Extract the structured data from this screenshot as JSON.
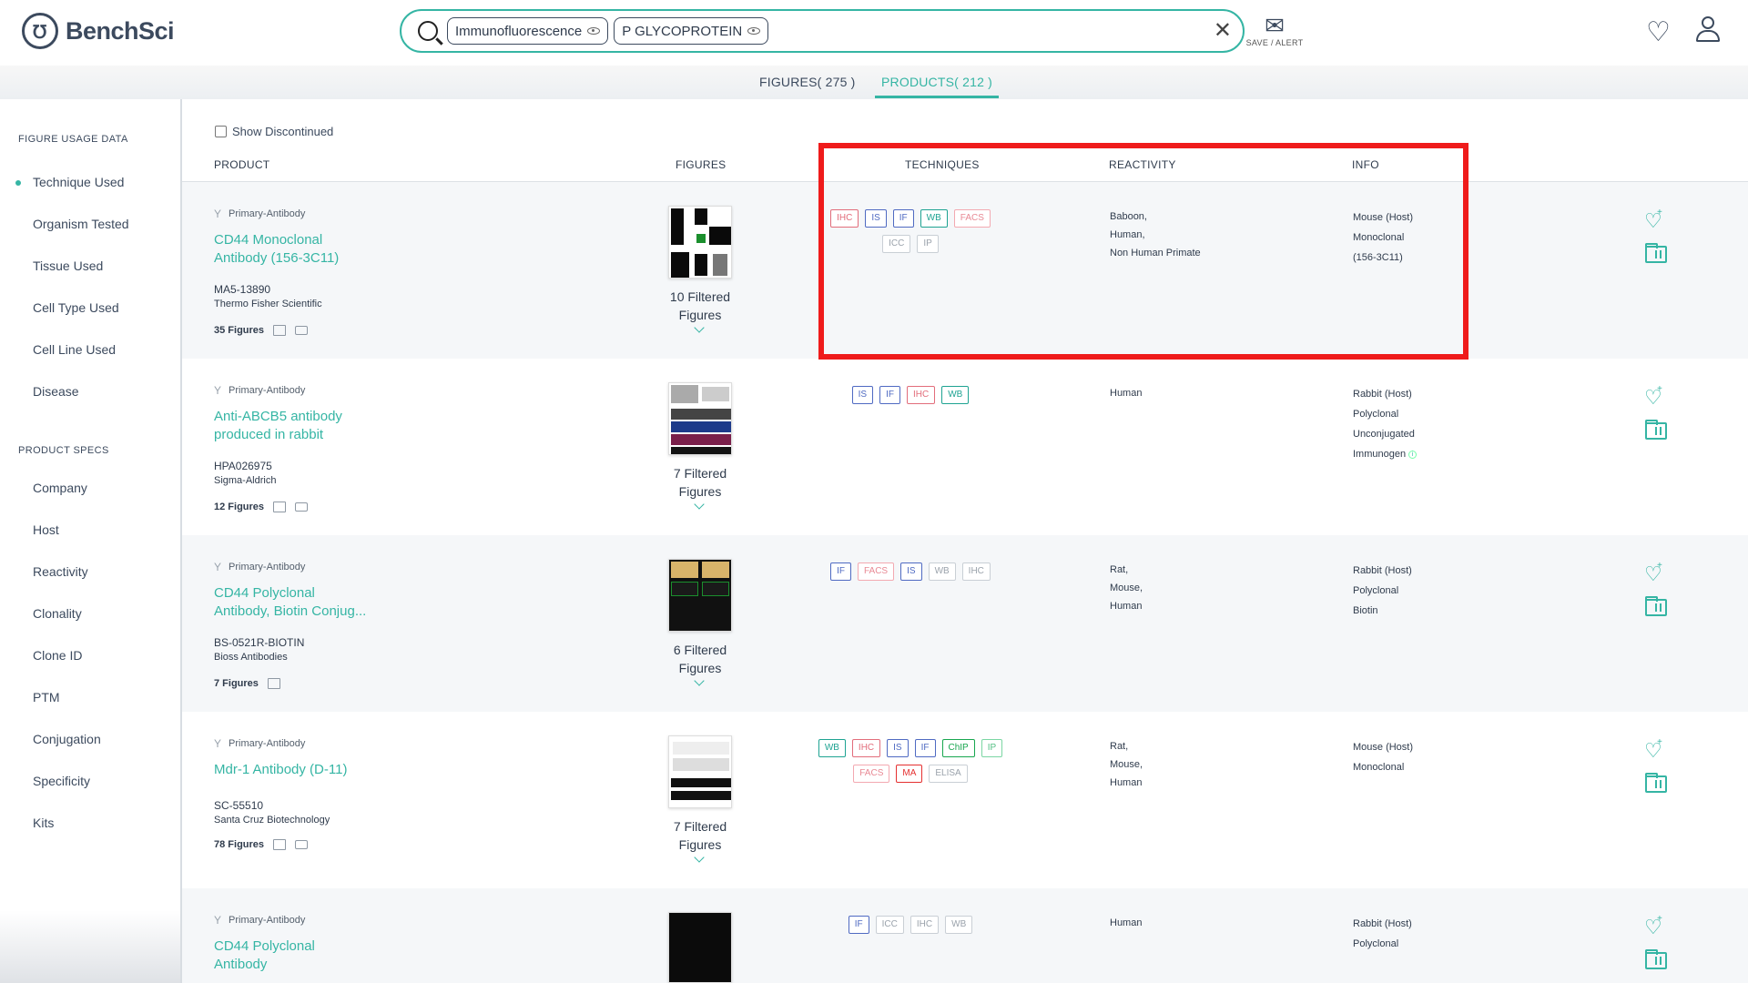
{
  "header": {
    "logo_text": "BenchSci",
    "search_chips": [
      "Immunofluorescence",
      "P GLYCOPROTEIN"
    ],
    "save_alert_label": "SAVE / ALERT"
  },
  "tabs": {
    "figures_label": "FIGURES",
    "figures_count": "( 275 )",
    "products_label": "PRODUCTS",
    "products_count": "( 212 )"
  },
  "sidebar": {
    "figure_usage_title": "FIGURE USAGE DATA",
    "figure_usage_items": [
      "Technique Used",
      "Organism Tested",
      "Tissue Used",
      "Cell Type Used",
      "Cell Line Used",
      "Disease"
    ],
    "product_specs_title": "PRODUCT SPECS",
    "product_specs_items": [
      "Company",
      "Host",
      "Reactivity",
      "Clonality",
      "Clone ID",
      "PTM",
      "Conjugation",
      "Specificity",
      "Kits"
    ]
  },
  "main": {
    "show_discontinued_label": "Show Discontinued",
    "columns": {
      "product": "PRODUCT",
      "figures": "FIGURES",
      "techniques": "TECHNIQUES",
      "reactivity": "REACTIVITY",
      "info": "INFO"
    }
  },
  "products": [
    {
      "type": "Primary-Antibody",
      "name_line1": "CD44 Monoclonal",
      "name_line2": "Antibody (156-3C11)",
      "catalog": "MA5-13890",
      "supplier": "Thermo Fisher Scientific",
      "figures_count": "35 Figures",
      "filtered_line1": "10 Filtered",
      "filtered_line2": "Figures",
      "techniques": [
        "IHC",
        "IS",
        "IF",
        "WB",
        "FACS",
        "ICC",
        "IP"
      ],
      "reactivity": [
        "Baboon,",
        "Human,",
        "Non Human Primate"
      ],
      "info": [
        "Mouse (Host)",
        "Monoclonal",
        "(156-3C11)"
      ]
    },
    {
      "type": "Primary-Antibody",
      "name_line1": "Anti-ABCB5 antibody",
      "name_line2": "produced in rabbit",
      "catalog": "HPA026975",
      "supplier": "Sigma-Aldrich",
      "figures_count": "12 Figures",
      "filtered_line1": "7 Filtered",
      "filtered_line2": "Figures",
      "techniques": [
        "IS",
        "IF",
        "IHC",
        "WB"
      ],
      "reactivity": [
        "Human"
      ],
      "info": [
        "Rabbit (Host)",
        "Polyclonal",
        "Unconjugated",
        "Immunogen"
      ]
    },
    {
      "type": "Primary-Antibody",
      "name_line1": "CD44 Polyclonal",
      "name_line2": "Antibody, Biotin Conjug...",
      "catalog": "BS-0521R-BIOTIN",
      "supplier": "Bioss Antibodies",
      "figures_count": "7 Figures",
      "filtered_line1": "6 Filtered",
      "filtered_line2": "Figures",
      "techniques": [
        "IF",
        "FACS",
        "IS",
        "WB",
        "IHC"
      ],
      "reactivity": [
        "Rat,",
        "Mouse,",
        "Human"
      ],
      "info": [
        "Rabbit (Host)",
        "Polyclonal",
        "Biotin"
      ]
    },
    {
      "type": "Primary-Antibody",
      "name_line1": "Mdr-1 Antibody (D-11)",
      "name_line2": "",
      "catalog": "SC-55510",
      "supplier": "Santa Cruz Biotechnology",
      "figures_count": "78 Figures",
      "filtered_line1": "7 Filtered",
      "filtered_line2": "Figures",
      "techniques": [
        "WB",
        "IHC",
        "IS",
        "IF",
        "ChIP",
        "IP",
        "FACS",
        "MA",
        "ELISA"
      ],
      "reactivity": [
        "Rat,",
        "Mouse,",
        "Human"
      ],
      "info": [
        "Mouse (Host)",
        "Monoclonal"
      ]
    },
    {
      "type": "Primary-Antibody",
      "name_line1": "CD44 Polyclonal",
      "name_line2": "Antibody",
      "reactivity": [
        "Human"
      ],
      "techniques": [
        "IF",
        "ICC",
        "IHC",
        "WB"
      ],
      "info": [
        "Rabbit (Host)",
        "Polyclonal"
      ]
    }
  ],
  "colors": {
    "accent": "#35b5a4",
    "highlight_box": "#ef1b1b"
  }
}
